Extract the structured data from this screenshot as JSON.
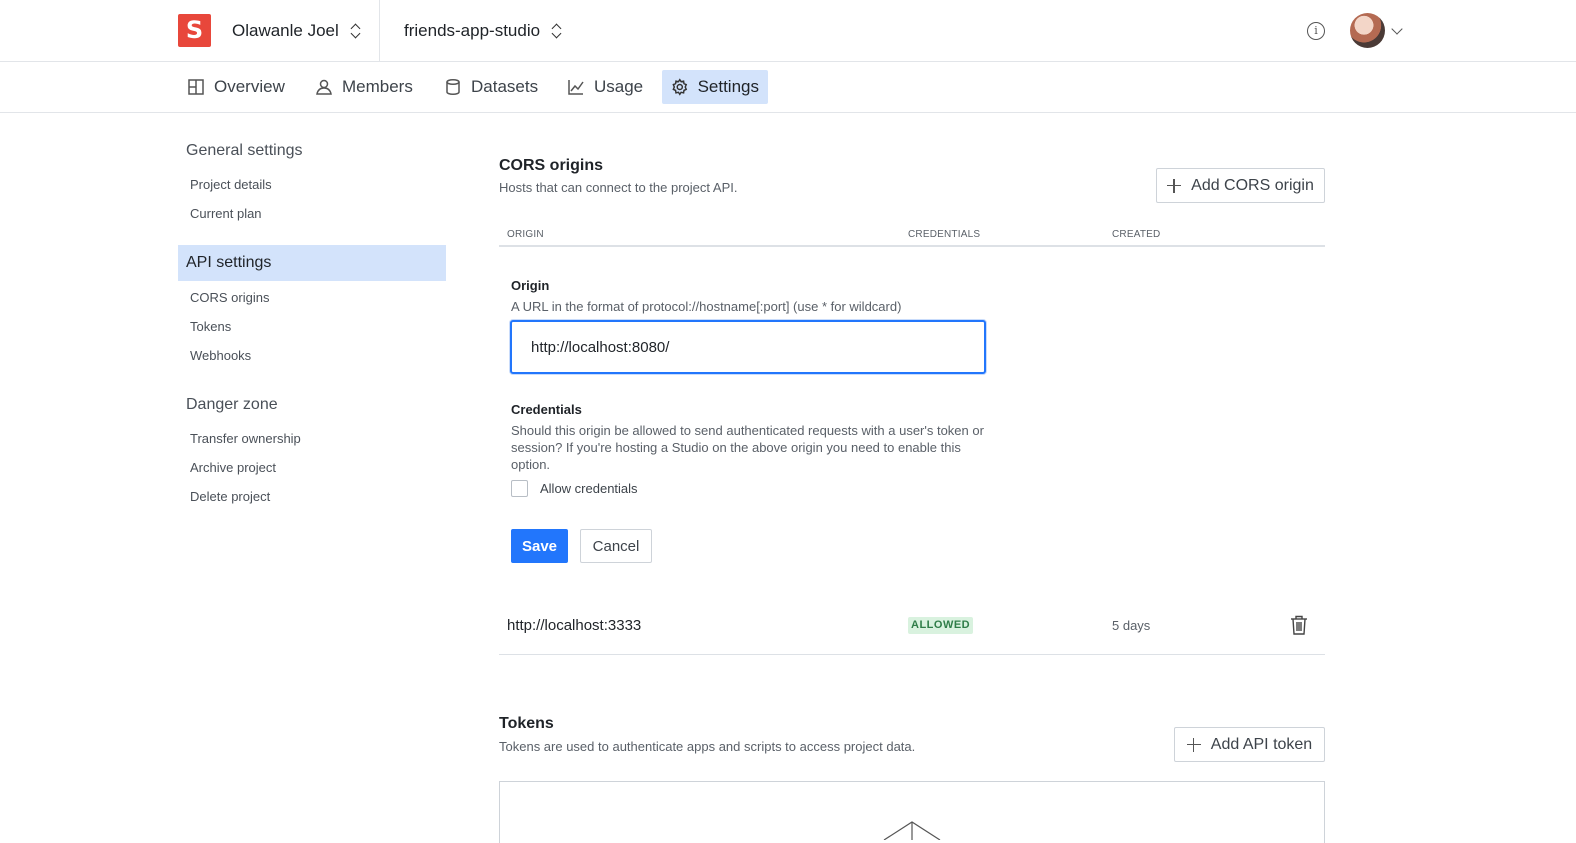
{
  "header": {
    "logo_letter": "S",
    "org_name": "Olawanle Joel",
    "project_name": "friends-app-studio",
    "info_glyph": "i"
  },
  "nav": {
    "tabs": [
      {
        "label": "Overview",
        "icon": "overview-icon"
      },
      {
        "label": "Members",
        "icon": "members-icon"
      },
      {
        "label": "Datasets",
        "icon": "datasets-icon"
      },
      {
        "label": "Usage",
        "icon": "usage-icon"
      },
      {
        "label": "Settings",
        "icon": "gear-icon",
        "active": true
      }
    ]
  },
  "sidebar": {
    "general": {
      "heading": "General settings",
      "items": [
        "Project details",
        "Current plan"
      ]
    },
    "api": {
      "heading": "API settings",
      "items": [
        "CORS origins",
        "Tokens",
        "Webhooks"
      ]
    },
    "danger": {
      "heading": "Danger zone",
      "items": [
        "Transfer ownership",
        "Archive project",
        "Delete project"
      ]
    }
  },
  "cors": {
    "title": "CORS origins",
    "description": "Hosts that can connect to the project API.",
    "add_button": "Add CORS origin",
    "columns": [
      "ORIGIN",
      "CREDENTIALS",
      "CREATED"
    ],
    "form": {
      "origin_label": "Origin",
      "origin_help": "A URL in the format of protocol://hostname[:port] (use * for wildcard)",
      "origin_value": "http://localhost:8080/",
      "credentials_label": "Credentials",
      "credentials_help": "Should this origin be allowed to send authenticated requests with a user's token or session? If you're hosting a Studio on the above origin you need to enable this option.",
      "allow_label": "Allow credentials",
      "allow_checked": false,
      "save_label": "Save",
      "cancel_label": "Cancel"
    },
    "rows": [
      {
        "origin": "http://localhost:3333",
        "credentials": "ALLOWED",
        "created": "5 days"
      }
    ]
  },
  "tokens": {
    "title": "Tokens",
    "description": "Tokens are used to authenticate apps and scripts to access project data.",
    "add_button": "Add API token"
  },
  "colors": {
    "accent": "#2276fc",
    "brand": "#e8473b",
    "active_bg": "#d3e3fb",
    "badge_bg": "#d9f2df",
    "badge_text": "#2f7d48"
  }
}
